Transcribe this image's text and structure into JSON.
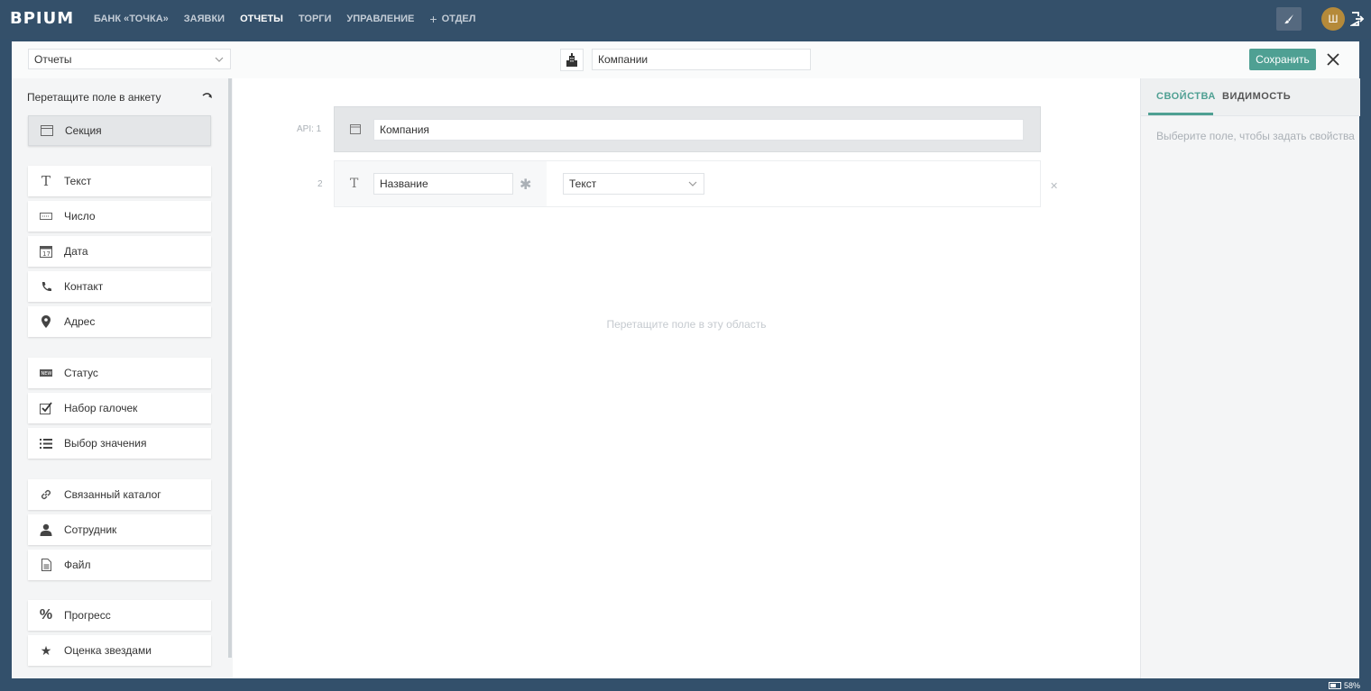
{
  "app": {
    "logo": "BPIUM"
  },
  "nav": {
    "items": [
      {
        "label": "БАНК «ТОЧКА»"
      },
      {
        "label": "ЗАЯВКИ"
      },
      {
        "label": "ОТЧЕТЫ"
      },
      {
        "label": "ТОРГИ"
      },
      {
        "label": "УПРАВЛЕНИЕ"
      }
    ],
    "add_label": "ОТДЕЛ",
    "active_index": 2
  },
  "user": {
    "initial": "Ш"
  },
  "header": {
    "section_select": "Отчеты",
    "catalog_name": "Компании",
    "save_label": "Сохранить"
  },
  "sidebar": {
    "hint": "Перетащите поле в анкету",
    "items": [
      {
        "label": "Секция",
        "icon": "section-icon"
      },
      {
        "label": "Текст",
        "icon": "text-icon"
      },
      {
        "label": "Число",
        "icon": "number-icon"
      },
      {
        "label": "Дата",
        "icon": "calendar-icon"
      },
      {
        "label": "Контакт",
        "icon": "phone-icon"
      },
      {
        "label": "Адрес",
        "icon": "map-pin-icon"
      },
      {
        "label": "Статус",
        "icon": "status-icon"
      },
      {
        "label": "Набор галочек",
        "icon": "checkbox-icon"
      },
      {
        "label": "Выбор значения",
        "icon": "list-icon"
      },
      {
        "label": "Связанный каталог",
        "icon": "link-icon"
      },
      {
        "label": "Сотрудник",
        "icon": "user-icon"
      },
      {
        "label": "Файл",
        "icon": "file-icon"
      },
      {
        "label": "Прогресс",
        "icon": "percent-icon"
      },
      {
        "label": "Оценка звездами",
        "icon": "star-icon"
      }
    ]
  },
  "form": {
    "section": {
      "api_label": "API: 1",
      "name": "Компания"
    },
    "fields": [
      {
        "api_label": "2",
        "name": "Название",
        "type": "Текст"
      }
    ],
    "drop_hint": "Перетащите поле в эту область"
  },
  "properties": {
    "tabs": [
      {
        "label": "СВОЙСТВА"
      },
      {
        "label": "ВИДИМОСТЬ"
      }
    ],
    "active_tab": 0,
    "hint": "Выберите поле, чтобы задать свойства"
  },
  "status_bar": {
    "battery": "58%"
  },
  "colors": {
    "topbar": "#34506a",
    "accent": "#4fa093",
    "avatar": "#b58a3a"
  }
}
